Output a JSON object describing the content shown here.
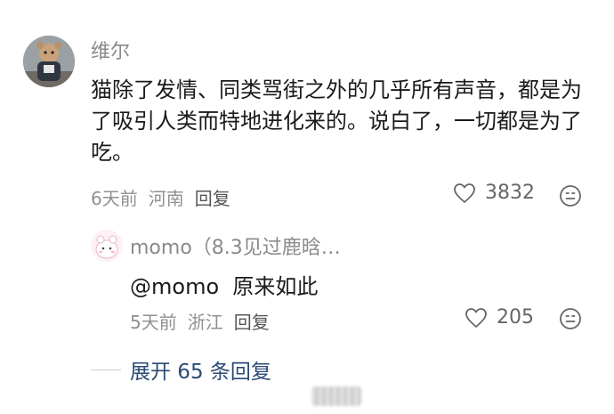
{
  "comment": {
    "username": "维尔",
    "text": "猫除了发情、同类骂街之外的几乎所有声音，都是为了吸引人类而特地进化来的。说白了，一切都是为了吃。",
    "time": "6天前",
    "location": "河南",
    "reply_label": "回复",
    "likes": "3832"
  },
  "reply": {
    "username": "momo（8.3见过鹿晗…",
    "mention": "@momo",
    "text": "原来如此",
    "time": "5天前",
    "location": "浙江",
    "reply_label": "回复",
    "likes": "205"
  },
  "expand": {
    "label": "展开 65 条回复"
  },
  "icons": {
    "like": "heart-outline-icon",
    "react": "smiley-face-icon"
  },
  "colors": {
    "link": "#2b4a73",
    "meta": "#909090"
  }
}
